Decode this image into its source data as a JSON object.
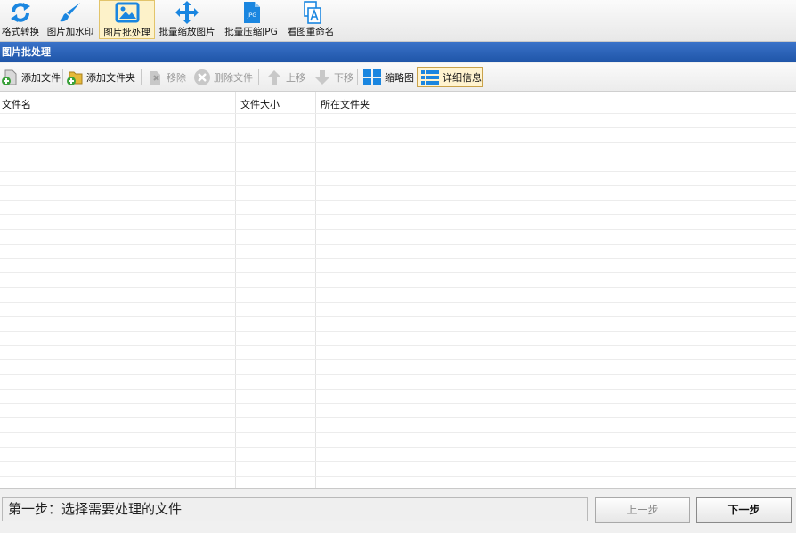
{
  "top_toolbar": {
    "tools": [
      {
        "label": "格式转换",
        "icon": "refresh-convert-icon"
      },
      {
        "label": "图片加水印",
        "icon": "paintbrush-icon"
      },
      {
        "label": "图片批处理",
        "icon": "image-icon"
      },
      {
        "label": "批量缩放图片",
        "icon": "move-arrows-icon"
      },
      {
        "label": "批量压缩JPG",
        "icon": "jpg-file-icon",
        "icon_text": "JPG"
      },
      {
        "label": "看图重命名",
        "icon": "rename-document-icon"
      }
    ]
  },
  "panel": {
    "title": "图片批处理"
  },
  "sub_toolbar": {
    "add_file": "添加文件",
    "add_folder": "添加文件夹",
    "remove": "移除",
    "delete_file": "删除文件",
    "move_up": "上移",
    "move_down": "下移",
    "thumbnail": "缩略图",
    "details": "详细信息"
  },
  "file_table": {
    "columns": [
      "文件名",
      "文件大小",
      "所在文件夹"
    ],
    "rows": []
  },
  "status": {
    "step_text": "第一步：选择需要处理的文件",
    "prev_label": "上一步",
    "next_label": "下一步"
  },
  "colors": {
    "title_bar": "#2a62b8",
    "accent_blue": "#1a86e0",
    "active_highlight": "#fdf2c9"
  }
}
